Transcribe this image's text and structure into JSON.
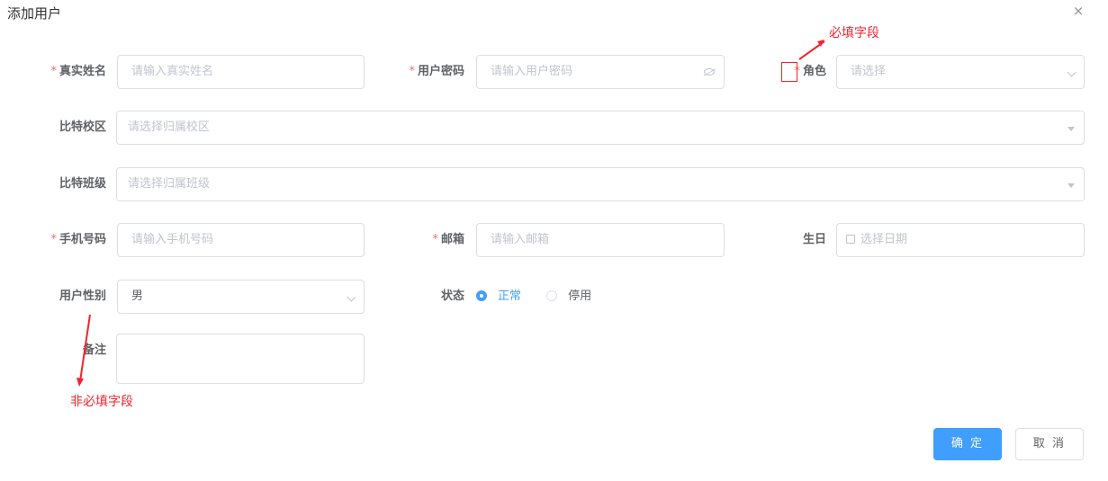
{
  "dialog": {
    "title": "添加用户",
    "close": "×"
  },
  "form": {
    "real_name": {
      "label": "真实姓名",
      "required": "*",
      "placeholder": "请输入真实姓名"
    },
    "password": {
      "label": "用户密码",
      "required": "*",
      "placeholder": "请输入用户密码"
    },
    "role": {
      "label": "角色",
      "required": "*",
      "placeholder": "请选择"
    },
    "campus": {
      "label": "比特校区",
      "placeholder": "请选择归属校区"
    },
    "class": {
      "label": "比特班级",
      "placeholder": "请选择归属班级"
    },
    "phone": {
      "label": "手机号码",
      "required": "*",
      "placeholder": "请输入手机号码"
    },
    "email": {
      "label": "邮箱",
      "required": "*",
      "placeholder": "请输入邮箱"
    },
    "birthday": {
      "label": "生日",
      "placeholder": "选择日期"
    },
    "gender": {
      "label": "用户性别",
      "value": "男"
    },
    "status": {
      "label": "状态",
      "options": [
        "正常",
        "停用"
      ],
      "selected": "正常"
    },
    "remark": {
      "label": "备注"
    }
  },
  "annotations": {
    "required_field": "必填字段",
    "optional_field": "非必填字段"
  },
  "buttons": {
    "confirm": "确 定",
    "cancel": "取 消"
  },
  "colors": {
    "primary": "#409eff",
    "required_star": "#f56c6c",
    "annotation": "#f5222d"
  }
}
